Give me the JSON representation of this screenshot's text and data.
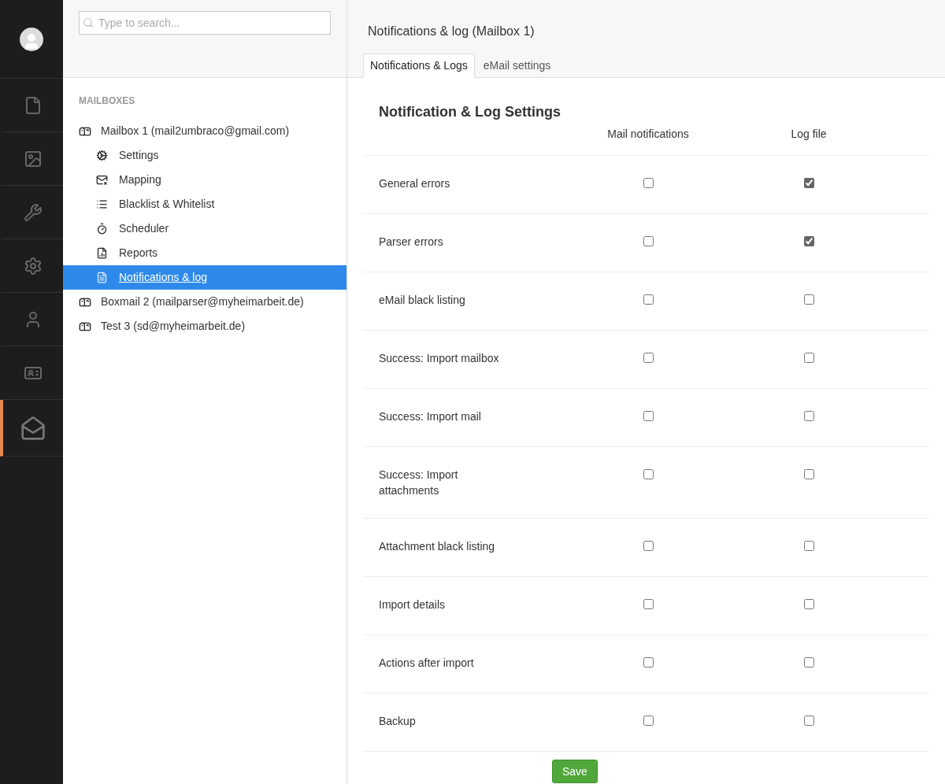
{
  "rail": [
    {
      "selected": false
    },
    {
      "selected": false
    },
    {
      "selected": false
    },
    {
      "selected": false
    },
    {
      "selected": false
    },
    {
      "selected": false
    },
    {
      "selected": true
    }
  ],
  "search": {
    "placeholder": "Type to search..."
  },
  "tree": {
    "heading": "MAILBOXES",
    "items": [
      {
        "label": "Mailbox 1 (mail2umbraco@gmail.com)",
        "selected": false,
        "children": [
          {
            "label": "Settings",
            "selected": false
          },
          {
            "label": "Mapping",
            "selected": false
          },
          {
            "label": "Blacklist & Whitelist",
            "selected": false
          },
          {
            "label": "Scheduler",
            "selected": false
          },
          {
            "label": "Reports",
            "selected": false
          },
          {
            "label": "Notifications & log",
            "selected": true
          }
        ]
      },
      {
        "label": "Boxmail 2 (mailparser@myheimarbeit.de)",
        "selected": false
      },
      {
        "label": "Test 3 (sd@myheimarbeit.de)",
        "selected": false
      }
    ]
  },
  "page": {
    "title": "Notifications & log (Mailbox 1)",
    "tabs": [
      {
        "label": "Notifications & Logs",
        "selected": true
      },
      {
        "label": "eMail settings",
        "selected": false
      }
    ]
  },
  "settings": {
    "heading": "Notification & Log Settings",
    "columns": [
      "Mail notifications",
      "Log file"
    ],
    "rows": [
      {
        "label": "General errors",
        "mail": false,
        "log": true
      },
      {
        "label": "Parser errors",
        "mail": false,
        "log": true
      },
      {
        "label": "eMail black listing",
        "mail": false,
        "log": false
      },
      {
        "label": "Success: Import mailbox",
        "mail": false,
        "log": false
      },
      {
        "label": "Success: Import mail",
        "mail": false,
        "log": false
      },
      {
        "label": "Success: Import attachments",
        "mail": false,
        "log": false
      },
      {
        "label": "Attachment black listing",
        "mail": false,
        "log": false
      },
      {
        "label": "Import details",
        "mail": false,
        "log": false
      },
      {
        "label": "Actions after import",
        "mail": false,
        "log": false
      },
      {
        "label": "Backup",
        "mail": false,
        "log": false
      }
    ]
  },
  "save_button": "Save"
}
